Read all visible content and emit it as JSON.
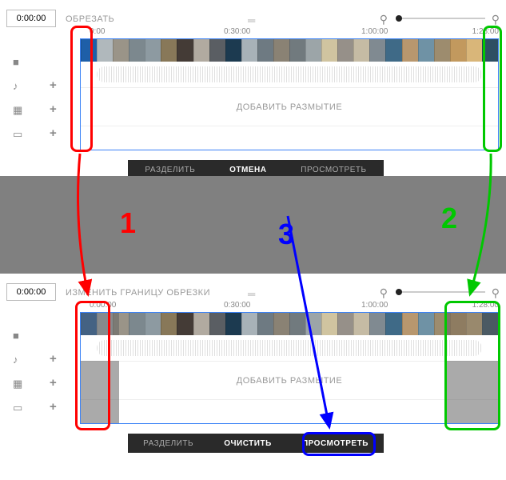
{
  "panels": {
    "top": {
      "time": "0:00:00",
      "title": "ОБРЕЗАТЬ",
      "ruler": {
        "t0": "0:00",
        "t1": "0:30:00",
        "t2": "1:00:00",
        "t3": "1:28:00"
      },
      "blur_label": "ДОБАВИТЬ РАЗМЫТИЕ",
      "actions": {
        "a": "РАЗДЕЛИТЬ",
        "b": "ОТМЕНА",
        "c": "ПРОСМОТРЕТЬ"
      }
    },
    "bottom": {
      "time": "0:00:00",
      "title": "ИЗМЕНИТЬ ГРАНИЦУ ОБРЕЗКИ",
      "ruler": {
        "t0": "0:00:00",
        "t1": "0:30:00",
        "t2": "1:00:00",
        "t3": "1:28:00"
      },
      "blur_label": "ДОБАВИТЬ РАЗМЫТИЕ",
      "actions": {
        "a": "РАЗДЕЛИТЬ",
        "b": "ОЧИСТИТЬ",
        "c": "ПРОСМОТРЕТЬ"
      }
    }
  },
  "annotations": {
    "n1": "1",
    "n2": "2",
    "n3": "3"
  },
  "colors": {
    "red": "#ff0000",
    "green": "#00c800",
    "blue": "#0000ff"
  },
  "thumb_colors": [
    "#1e5fa8",
    "#b0b8bc",
    "#9a9488",
    "#7c888e",
    "#8d9aa1",
    "#887859",
    "#443b36",
    "#b1aaa0",
    "#5a5e63",
    "#1c3a50",
    "#a8b2b8",
    "#6e7a82",
    "#8a8274",
    "#717a7e",
    "#9ca5a8",
    "#d0c4a0",
    "#969089",
    "#c5bba4",
    "#808a91",
    "#3f6a87",
    "#b8976e",
    "#6f92a5",
    "#9d8c6e",
    "#c2995e",
    "#d9b679",
    "#2d4f63"
  ]
}
